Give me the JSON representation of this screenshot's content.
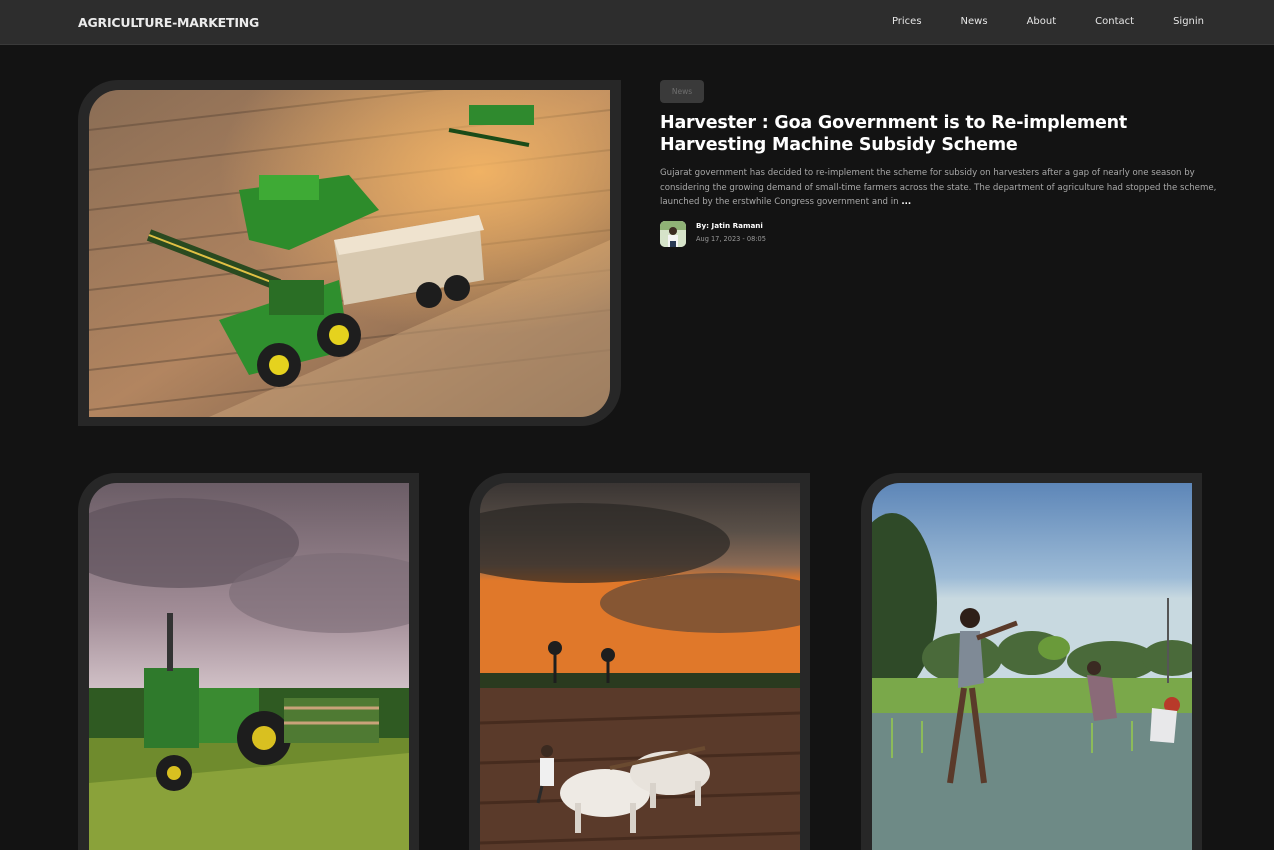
{
  "brand": "AGRICULTURE-MARKETING",
  "nav": [
    {
      "label": "Prices"
    },
    {
      "label": "News"
    },
    {
      "label": "About"
    },
    {
      "label": "Contact"
    },
    {
      "label": "Signin"
    }
  ],
  "featured": {
    "category": "News",
    "title": "Harvester : Goa Government is to Re-implement Harvesting Machine Subsidy Scheme",
    "excerpt": "Gujarat government has decided to re-implement the scheme for subsidy on harvesters after a gap of nearly one season by considering the growing demand of small-time farmers across the state. The department of agriculture had stopped the scheme, launched by the erstwhile Congress government and in",
    "more": "...",
    "author": "By: Jatin Ramani",
    "date": "Aug 17, 2023 - 08:05"
  },
  "icons": {
    "hero": "harvester-photo",
    "card1": "tractor-photo",
    "card2": "oxen-plough-photo",
    "card3": "rice-planting-photo",
    "avatar": "author-avatar"
  }
}
